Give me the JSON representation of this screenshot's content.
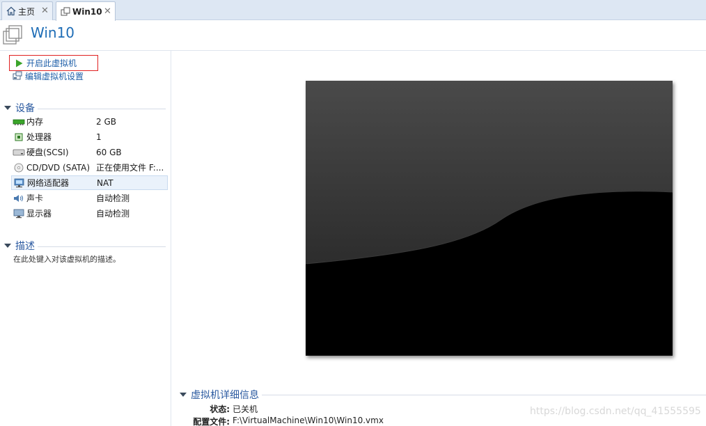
{
  "tabs": [
    {
      "label": "主页",
      "icon": "home-icon"
    },
    {
      "label": "Win10",
      "icon": "vm-icon"
    }
  ],
  "title": "Win10",
  "actions": {
    "power_on": "开启此虚拟机",
    "edit_settings": "编辑虚拟机设置"
  },
  "devices": {
    "heading": "设备",
    "items": [
      {
        "name": "内存",
        "value": "2 GB",
        "icon": "memory-icon"
      },
      {
        "name": "处理器",
        "value": "1",
        "icon": "processor-icon"
      },
      {
        "name": "硬盘(SCSI)",
        "value": "60 GB",
        "icon": "hard-disk-icon"
      },
      {
        "name": "CD/DVD (SATA)",
        "value": "正在使用文件 F:...",
        "icon": "cd-dvd-icon"
      },
      {
        "name": "网络适配器",
        "value": "NAT",
        "icon": "network-adapter-icon"
      },
      {
        "name": "声卡",
        "value": "自动检测",
        "icon": "sound-card-icon"
      },
      {
        "name": "显示器",
        "value": "自动检测",
        "icon": "display-icon"
      }
    ]
  },
  "description": {
    "heading": "描述",
    "placeholder": "在此处键入对该虚拟机的描述。"
  },
  "details": {
    "heading": "虚拟机详细信息",
    "status_label": "状态:",
    "status_value": "已关机",
    "config_label": "配置文件:",
    "config_value": "F:\\VirtualMachine\\Win10\\Win10.vmx"
  },
  "watermark": "https://blog.csdn.net/qq_41555595",
  "colors": {
    "accent": "#1e6db6",
    "link": "#1e5fa8",
    "highlight_border": "#e02020",
    "play_green": "#3aa52a"
  }
}
